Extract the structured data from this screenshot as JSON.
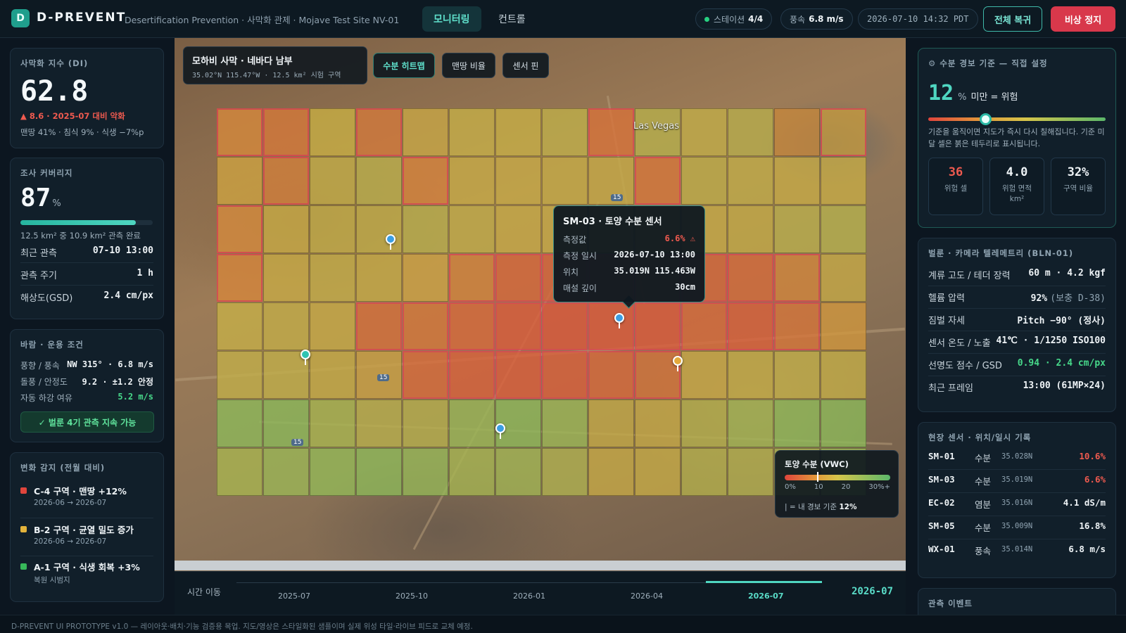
{
  "header": {
    "logo_letter": "D",
    "brand": "D-PREVENT",
    "subtitle": "Desertification Prevention · 사막화 관제 · Mojave Test Site NV-01",
    "tabs": [
      {
        "label": "모니터링",
        "active": true
      },
      {
        "label": "컨트롤",
        "active": false
      }
    ],
    "station_label": "스테이션",
    "station_value": "4/4",
    "wind_label": "풍속",
    "wind_value": "6.8 m/s",
    "datetime": "2026-07-10 14:32 PDT",
    "restore_label": "전체 복귀",
    "stop_label": "비상 정지"
  },
  "left": {
    "di": {
      "title": "사막화 지수 (DI)",
      "value": "62.8",
      "change": "▲ 8.6 · 2025-07 대비 악화",
      "breakdown": "맨땅 41% · 침식 9% · 식생 −7%p"
    },
    "coverage": {
      "title": "조사 커버리지",
      "value": "87",
      "unit": "%",
      "progress": 0.87,
      "caption": "12.5 km² 중 10.9 km² 관측 완료",
      "rows": [
        {
          "label": "최근 관측",
          "value": "07-10 13:00"
        },
        {
          "label": "관측 주기",
          "value": "1 h"
        },
        {
          "label": "해상도(GSD)",
          "value": "2.4 cm/px"
        }
      ]
    },
    "wind": {
      "title": "바람 · 운용 조건",
      "rows": [
        {
          "label": "풍향 / 풍속",
          "value": "NW 315° · 6.8 m/s"
        },
        {
          "label": "돌풍 / 안정도",
          "value": "9.2 · ±1.2 안정"
        },
        {
          "label": "자동 하강 여유",
          "value": "5.2 m/s"
        }
      ],
      "status": "✓ 벌룬 4기 관측 지속 가능"
    },
    "changes": {
      "title": "변화 감지 (전월 대비)",
      "items": [
        {
          "color": "#e0453c",
          "title": "C-4 구역 · 맨땅 +12%",
          "sub": "2026-06 → 2026-07"
        },
        {
          "color": "#e3b33b",
          "title": "B-2 구역 · 균열 밀도 증가",
          "sub": "2026-06 → 2026-07"
        },
        {
          "color": "#37b85a",
          "title": "A-1 구역 · 식생 회복 +3%",
          "sub": "복원 시범지"
        }
      ]
    }
  },
  "map": {
    "title": "모하비 사막 · 네바다 남부",
    "subtitle": "35.02°N 115.47°W · 12.5 km² 시험 구역",
    "city_label": "Las Vegas",
    "road_labels": [
      "15",
      "15",
      "15"
    ],
    "layers": [
      {
        "label": "수분 히트맵",
        "active": true
      },
      {
        "label": "맨땅 비율",
        "active": false
      },
      {
        "label": "센서 핀",
        "active": false
      }
    ],
    "grid_colors": [
      [
        "#d88a3c",
        "#d77a3a",
        "#c9b044",
        "#d47a3c",
        "#c9a846",
        "#c7b048",
        "#c8b046",
        "#c0b04a",
        "#d8733a",
        "#b7b04c",
        "#c2ae48",
        "#b8ae4c",
        "#c7883c",
        "#c49a40"
      ],
      [
        "#cfa442",
        "#d3803c",
        "#c3ae48",
        "#bbb04c",
        "#d7843c",
        "#c8ac46",
        "#c9ac46",
        "#c6ac46",
        "#c6aa46",
        "#d7773a",
        "#bfae48",
        "#c3ae48",
        "#c8ac46",
        "#c7ac46"
      ],
      [
        "#d78c3e",
        "#c9ac46",
        "#c3ae48",
        "#c1ae48",
        "#b9b04c",
        "#c2ae48",
        "#c9ac46",
        "#c8ac46",
        "#c9ac46",
        "#ccaa44",
        "#c8ac46",
        "#c5ac46",
        "#bbb04c",
        "#b6b24e"
      ],
      [
        "#d7873c",
        "#c9ac46",
        "#c4ae48",
        "#c6ac46",
        "#cfa444",
        "#d4843c",
        "#d9683a",
        "#d8643a",
        "#d9643a",
        "#d5703a",
        "#d7683a",
        "#d86c3a",
        "#d3863c",
        "#c6aa46"
      ],
      [
        "#c7b048",
        "#c4ae48",
        "#c8ac46",
        "#d7703a",
        "#d7783a",
        "#da6a3a",
        "#dd5c3a",
        "#de583a",
        "#de5a3a",
        "#de5a3a",
        "#da6a3a",
        "#dc603a",
        "#d7763a",
        "#d2983e"
      ],
      [
        "#c3b04a",
        "#c2b04a",
        "#c6ac46",
        "#cba244",
        "#da6c3a",
        "#dc623a",
        "#dd5e3a",
        "#dc603a",
        "#da6a3a",
        "#d5743a",
        "#c9aa46",
        "#c4ae48",
        "#c2b04a",
        "#c4ae48"
      ],
      [
        "#8eba5a",
        "#8cba5a",
        "#a8b650",
        "#b8b04c",
        "#b6b04c",
        "#9ab856",
        "#8eba5a",
        "#9cb856",
        "#c4aa46",
        "#c6aa46",
        "#b4b04c",
        "#a2b654",
        "#8eba5a",
        "#8cba5a"
      ],
      [
        "#a9b650",
        "#9cb856",
        "#94ba58",
        "#8eba5a",
        "#96b858",
        "#a6b652",
        "#a2b654",
        "#b0b250",
        "#c7aa46",
        "#c7ac46",
        "#b4b04c",
        "#b2b04e",
        "#aab452",
        "#9cb856"
      ]
    ],
    "alert_cells": [
      [
        0,
        0
      ],
      [
        0,
        1
      ],
      [
        0,
        3
      ],
      [
        0,
        8
      ],
      [
        0,
        13
      ],
      [
        1,
        1
      ],
      [
        1,
        4
      ],
      [
        1,
        9
      ],
      [
        2,
        0
      ],
      [
        3,
        0
      ],
      [
        3,
        5
      ],
      [
        3,
        6
      ],
      [
        3,
        7
      ],
      [
        3,
        8
      ],
      [
        3,
        9
      ],
      [
        3,
        10
      ],
      [
        3,
        11
      ],
      [
        3,
        12
      ],
      [
        4,
        3
      ],
      [
        4,
        4
      ],
      [
        4,
        5
      ],
      [
        4,
        6
      ],
      [
        4,
        7
      ],
      [
        4,
        8
      ],
      [
        4,
        9
      ],
      [
        4,
        10
      ],
      [
        4,
        11
      ],
      [
        4,
        12
      ],
      [
        5,
        4
      ],
      [
        5,
        5
      ],
      [
        5,
        6
      ],
      [
        5,
        7
      ],
      [
        5,
        8
      ],
      [
        5,
        9
      ]
    ],
    "pins": [
      {
        "color": "#3b9ee3"
      },
      {
        "color": "#2fc4b2"
      },
      {
        "color": "#3b9ee3"
      },
      {
        "color": "#e3a93b"
      },
      {
        "color": "#3b9ee3"
      }
    ],
    "tooltip": {
      "title": "SM-03 · 토양 수분 센서",
      "rows": [
        {
          "label": "측정값",
          "value": "6.6% ⚠",
          "alert": true
        },
        {
          "label": "측정 일시",
          "value": "2026-07-10 13:00"
        },
        {
          "label": "위치",
          "value": "35.019N 115.463W"
        },
        {
          "label": "매설 깊이",
          "value": "30cm"
        }
      ]
    },
    "legend": {
      "title": "토양 수분 (VWC)",
      "ticks": [
        "0%",
        "10",
        "20",
        "30%+"
      ],
      "note_prefix": "| = 내 경보 기준",
      "note_value": "12%"
    }
  },
  "timeline": {
    "label": "시간 이동",
    "ticks": [
      "2025-07",
      "2025-10",
      "2026-01",
      "2026-04",
      "2026-07"
    ],
    "active_index": 4,
    "current": "2026-07"
  },
  "right": {
    "alert": {
      "title": "⚙ 수분 경보 기준 — 직접 설정",
      "value": "12",
      "unit": "%",
      "suffix": "미만 = 위험",
      "slider_level": 0.32,
      "hint": "기준을 움직이면 지도가 즉시 다시 칠해집니다. 기준 미달 셀은 붉은 테두리로 표시됩니다.",
      "stats": [
        {
          "value": "36",
          "label": "위험 셀",
          "color": "#ef5a4f"
        },
        {
          "value": "4.0",
          "label": "위험 면적 km²",
          "color": "#eef3f6"
        },
        {
          "value": "32%",
          "label": "구역 비율",
          "color": "#eef3f6"
        }
      ]
    },
    "balloon": {
      "title": "벌룬 · 카메라 텔레메트리 (BLN-01)",
      "rows": [
        {
          "label": "계류 고도 / 테더 장력",
          "value": "60 m · 4.2 kgf"
        },
        {
          "label": "헬륨 압력",
          "value": "92%",
          "extra": "(보충 D-38)"
        },
        {
          "label": "짐벌 자세",
          "value": "Pitch −90° (정사)"
        },
        {
          "label": "센서 온도 / 노출",
          "value": "41℃ · 1/1250 ISO100"
        },
        {
          "label": "선명도 점수 / GSD",
          "value": "0.94 · 2.4 cm/px",
          "green": true
        },
        {
          "label": "최근 프레임",
          "value": "13:00 (61MP×24)"
        }
      ]
    },
    "sensors": {
      "title": "현장 센서 · 위치/일시 기록",
      "rows": [
        {
          "id": "SM-01",
          "kind": "수분",
          "lat": "35.028N",
          "value": "10.6%",
          "alert": true
        },
        {
          "id": "SM-03",
          "kind": "수분",
          "lat": "35.019N",
          "value": "6.6%",
          "alert": true
        },
        {
          "id": "EC-02",
          "kind": "염분",
          "lat": "35.016N",
          "value": "4.1 dS/m",
          "alert": false
        },
        {
          "id": "SM-05",
          "kind": "수분",
          "lat": "35.009N",
          "value": "16.8%",
          "alert": false
        },
        {
          "id": "WX-01",
          "kind": "풍속",
          "lat": "35.014N",
          "value": "6.8 m/s",
          "alert": false
        }
      ]
    },
    "events": {
      "title": "관측 이벤트"
    }
  },
  "footer": "D-PREVENT UI PROTOTYPE v1.0 — 레이아웃·배치·기능 검증용 목업. 지도/영상은 스타일화된 샘플이며 실제 위성 타일·라이브 피드로 교체 예정."
}
